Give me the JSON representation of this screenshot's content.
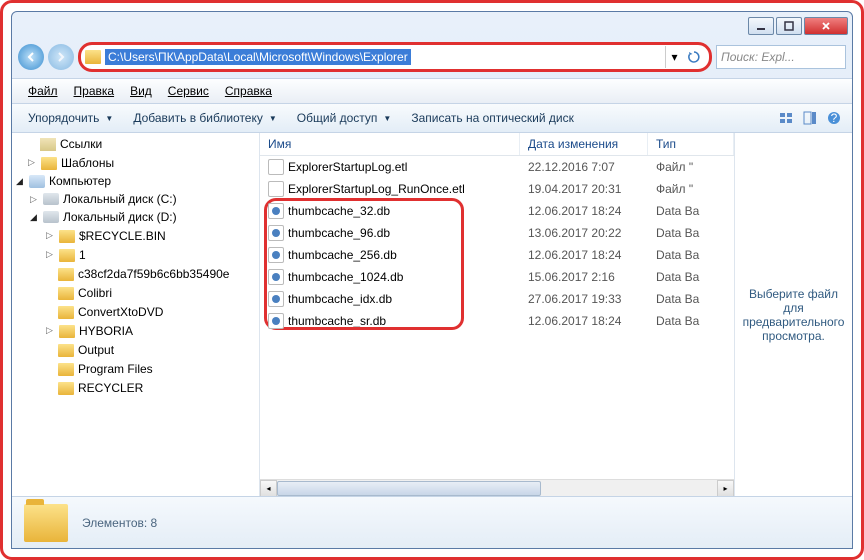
{
  "address_path": "C:\\Users\\ПК\\AppData\\Local\\Microsoft\\Windows\\Explorer",
  "search_placeholder": "Поиск: Expl...",
  "menu": {
    "file": "Файл",
    "edit": "Правка",
    "view": "Вид",
    "tools": "Сервис",
    "help": "Справка"
  },
  "toolbar": {
    "organize": "Упорядочить",
    "add_to_library": "Добавить в библиотеку",
    "share": "Общий доступ",
    "burn": "Записать на оптический диск"
  },
  "tree": {
    "links": "Ссылки",
    "templates": "Шаблоны",
    "computer": "Компьютер",
    "drive_c": "Локальный диск (C:)",
    "drive_d": "Локальный диск (D:)",
    "recycle": "$RECYCLE.BIN",
    "folder_1": "1",
    "folder_hash": "c38cf2da7f59b6c6bb35490e",
    "colibri": "Colibri",
    "convertx": "ConvertXtoDVD",
    "hyboria": "HYBORIA",
    "output": "Output",
    "program_files": "Program Files",
    "recycler": "RECYCLER"
  },
  "columns": {
    "name": "Имя",
    "date": "Дата изменения",
    "type": "Тип"
  },
  "files": [
    {
      "name": "ExplorerStartupLog.etl",
      "date": "22.12.2016 7:07",
      "type": "Файл \"",
      "kind": "etl"
    },
    {
      "name": "ExplorerStartupLog_RunOnce.etl",
      "date": "19.04.2017 20:31",
      "type": "Файл \"",
      "kind": "etl"
    },
    {
      "name": "thumbcache_32.db",
      "date": "12.06.2017 18:24",
      "type": "Data Ba",
      "kind": "db"
    },
    {
      "name": "thumbcache_96.db",
      "date": "13.06.2017 20:22",
      "type": "Data Ba",
      "kind": "db"
    },
    {
      "name": "thumbcache_256.db",
      "date": "12.06.2017 18:24",
      "type": "Data Ba",
      "kind": "db"
    },
    {
      "name": "thumbcache_1024.db",
      "date": "15.06.2017 2:16",
      "type": "Data Ba",
      "kind": "db"
    },
    {
      "name": "thumbcache_idx.db",
      "date": "27.06.2017 19:33",
      "type": "Data Ba",
      "kind": "db"
    },
    {
      "name": "thumbcache_sr.db",
      "date": "12.06.2017 18:24",
      "type": "Data Ba",
      "kind": "db"
    }
  ],
  "preview_text": "Выберите файл для предварительного просмотра.",
  "status": {
    "elements_label": "Элементов: 8"
  }
}
